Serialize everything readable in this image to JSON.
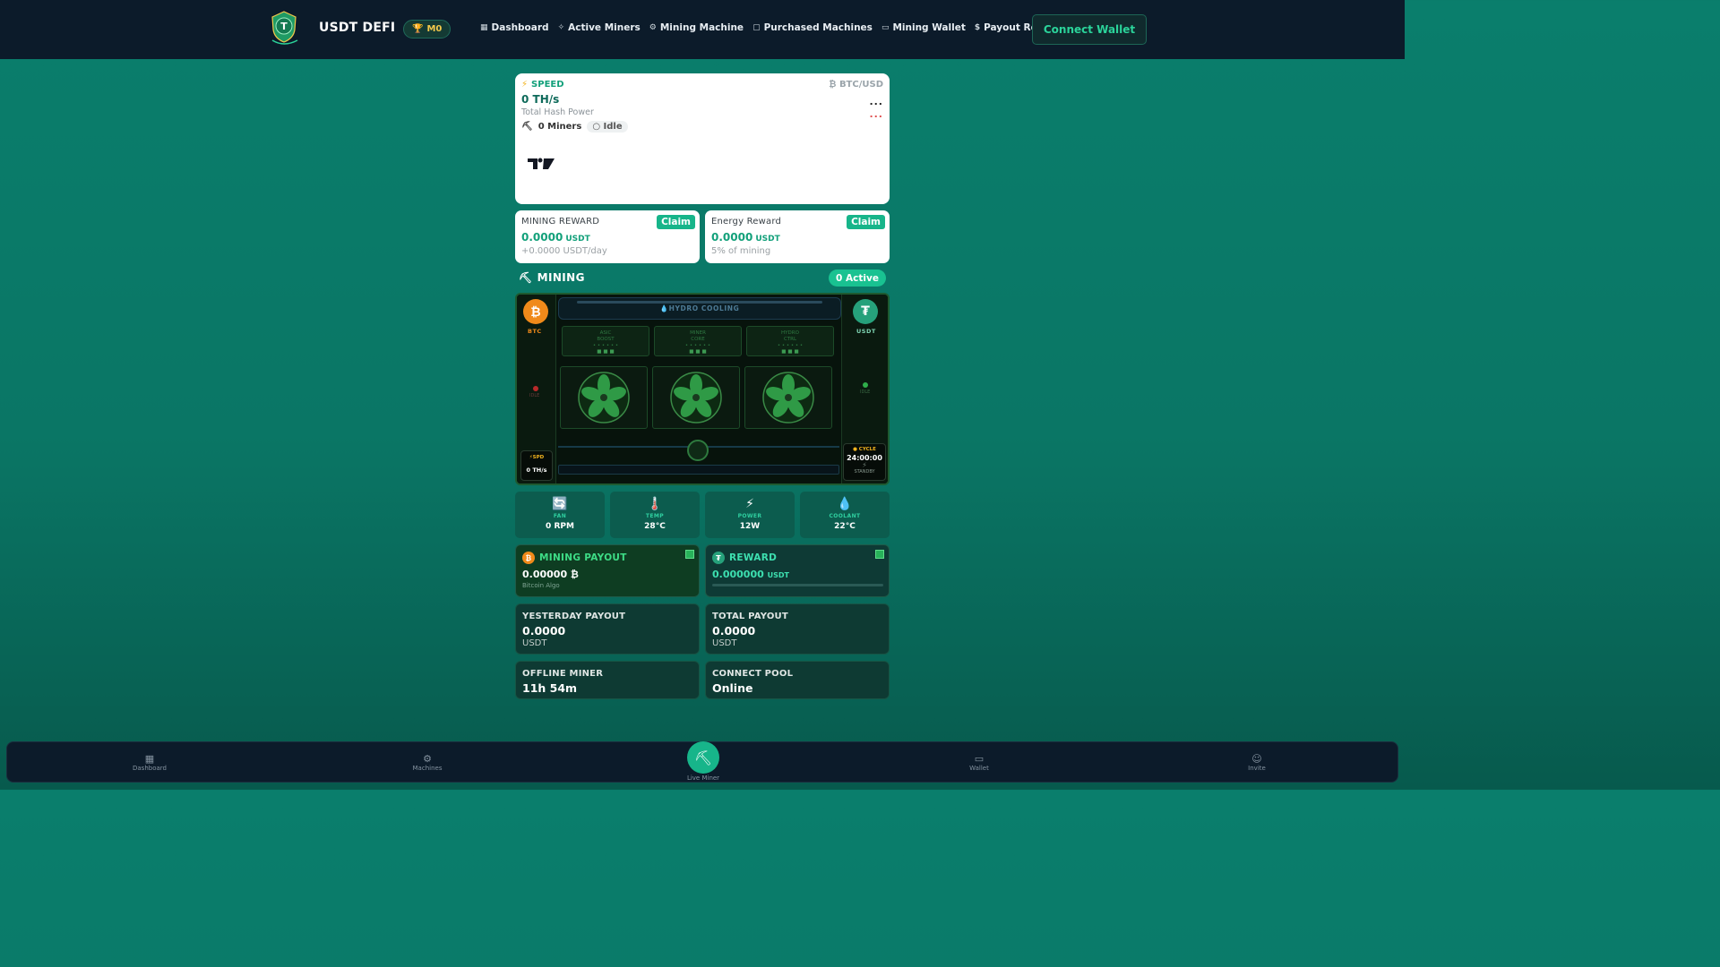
{
  "header": {
    "brand": "USDT DEFI",
    "rank": "M0",
    "nav": [
      {
        "label": "Dashboard",
        "icon": "grid-icon"
      },
      {
        "label": "Active Miners",
        "icon": "sparkle-icon"
      },
      {
        "label": "Mining Machine",
        "icon": "chip-icon"
      },
      {
        "label": "Purchased Machines",
        "icon": "bag-icon"
      },
      {
        "label": "Mining Wallet",
        "icon": "wallet-icon"
      },
      {
        "label": "Payout Records",
        "icon": "dollar-icon"
      }
    ],
    "connect_label": "Connect Wallet"
  },
  "speed_card": {
    "label": "SPEED",
    "pair": "BTC/USD",
    "value": "0 TH/s",
    "subtitle": "Total Hash Power",
    "miners": "0 Miners",
    "status": "Idle",
    "dots_top": "...",
    "dots_bottom": "..."
  },
  "rewards": {
    "mining": {
      "title": "MINING REWARD",
      "value": "0.0000",
      "unit": "USDT",
      "sub": "+0.0000 USDT/day",
      "claim": "Claim"
    },
    "energy": {
      "title": "Energy Reward",
      "value": "0.0000",
      "unit": "USDT",
      "sub": "5% of mining",
      "claim": "Claim"
    }
  },
  "mining": {
    "title": "MINING",
    "active": "0 Active",
    "left_coin": "BTC",
    "right_coin": "USDT",
    "cooling": "HYDRO COOLING",
    "panels": [
      {
        "l1": "ASIC",
        "l2": "BOOST"
      },
      {
        "l1": "MINER",
        "l2": "CORE"
      },
      {
        "l1": "HYDRO",
        "l2": "CTRL"
      }
    ],
    "left_status": "IDLE",
    "right_status": "IDLE",
    "spd_label": "SPD",
    "spd_value": "0 TH/s",
    "cycle_label": "CYCLE",
    "cycle_value": "24:00:00",
    "cycle_status": "STANDBY"
  },
  "stats": [
    {
      "icon": "🔄",
      "label": "FAN",
      "value": "0 RPM"
    },
    {
      "icon": "🌡️",
      "label": "TEMP",
      "value": "28°C"
    },
    {
      "icon": "⚡",
      "label": "POWER",
      "value": "12W"
    },
    {
      "icon": "💧",
      "label": "COOLANT",
      "value": "22°C"
    }
  ],
  "payout": {
    "mining": {
      "title": "MINING PAYOUT",
      "value": "0.00000 ₿",
      "sub": "Bitcoin Algo"
    },
    "reward": {
      "title": "REWARD",
      "value": "0.000000",
      "unit": "USDT"
    }
  },
  "info": {
    "yesterday": {
      "title": "YESTERDAY PAYOUT",
      "value": "0.0000",
      "unit": "USDT"
    },
    "total": {
      "title": "TOTAL PAYOUT",
      "value": "0.0000",
      "unit": "USDT"
    },
    "offline": {
      "title": "OFFLINE MINER",
      "value": "11h 54m"
    },
    "pool": {
      "title": "CONNECT POOL",
      "value": "Online"
    }
  },
  "bottom_nav": [
    {
      "label": "Dashboard",
      "icon": "grid-icon"
    },
    {
      "label": "Machines",
      "icon": "gear-icon"
    },
    {
      "label": "Live Miner",
      "icon": "pickaxe-icon"
    },
    {
      "label": "Wallet",
      "icon": "wallet-icon"
    },
    {
      "label": "Invite",
      "icon": "users-icon"
    }
  ],
  "colors": {
    "accent": "#17b58a",
    "bg": "#0a7665",
    "nav": "#0c1b2a",
    "btc": "#f08a1a"
  }
}
